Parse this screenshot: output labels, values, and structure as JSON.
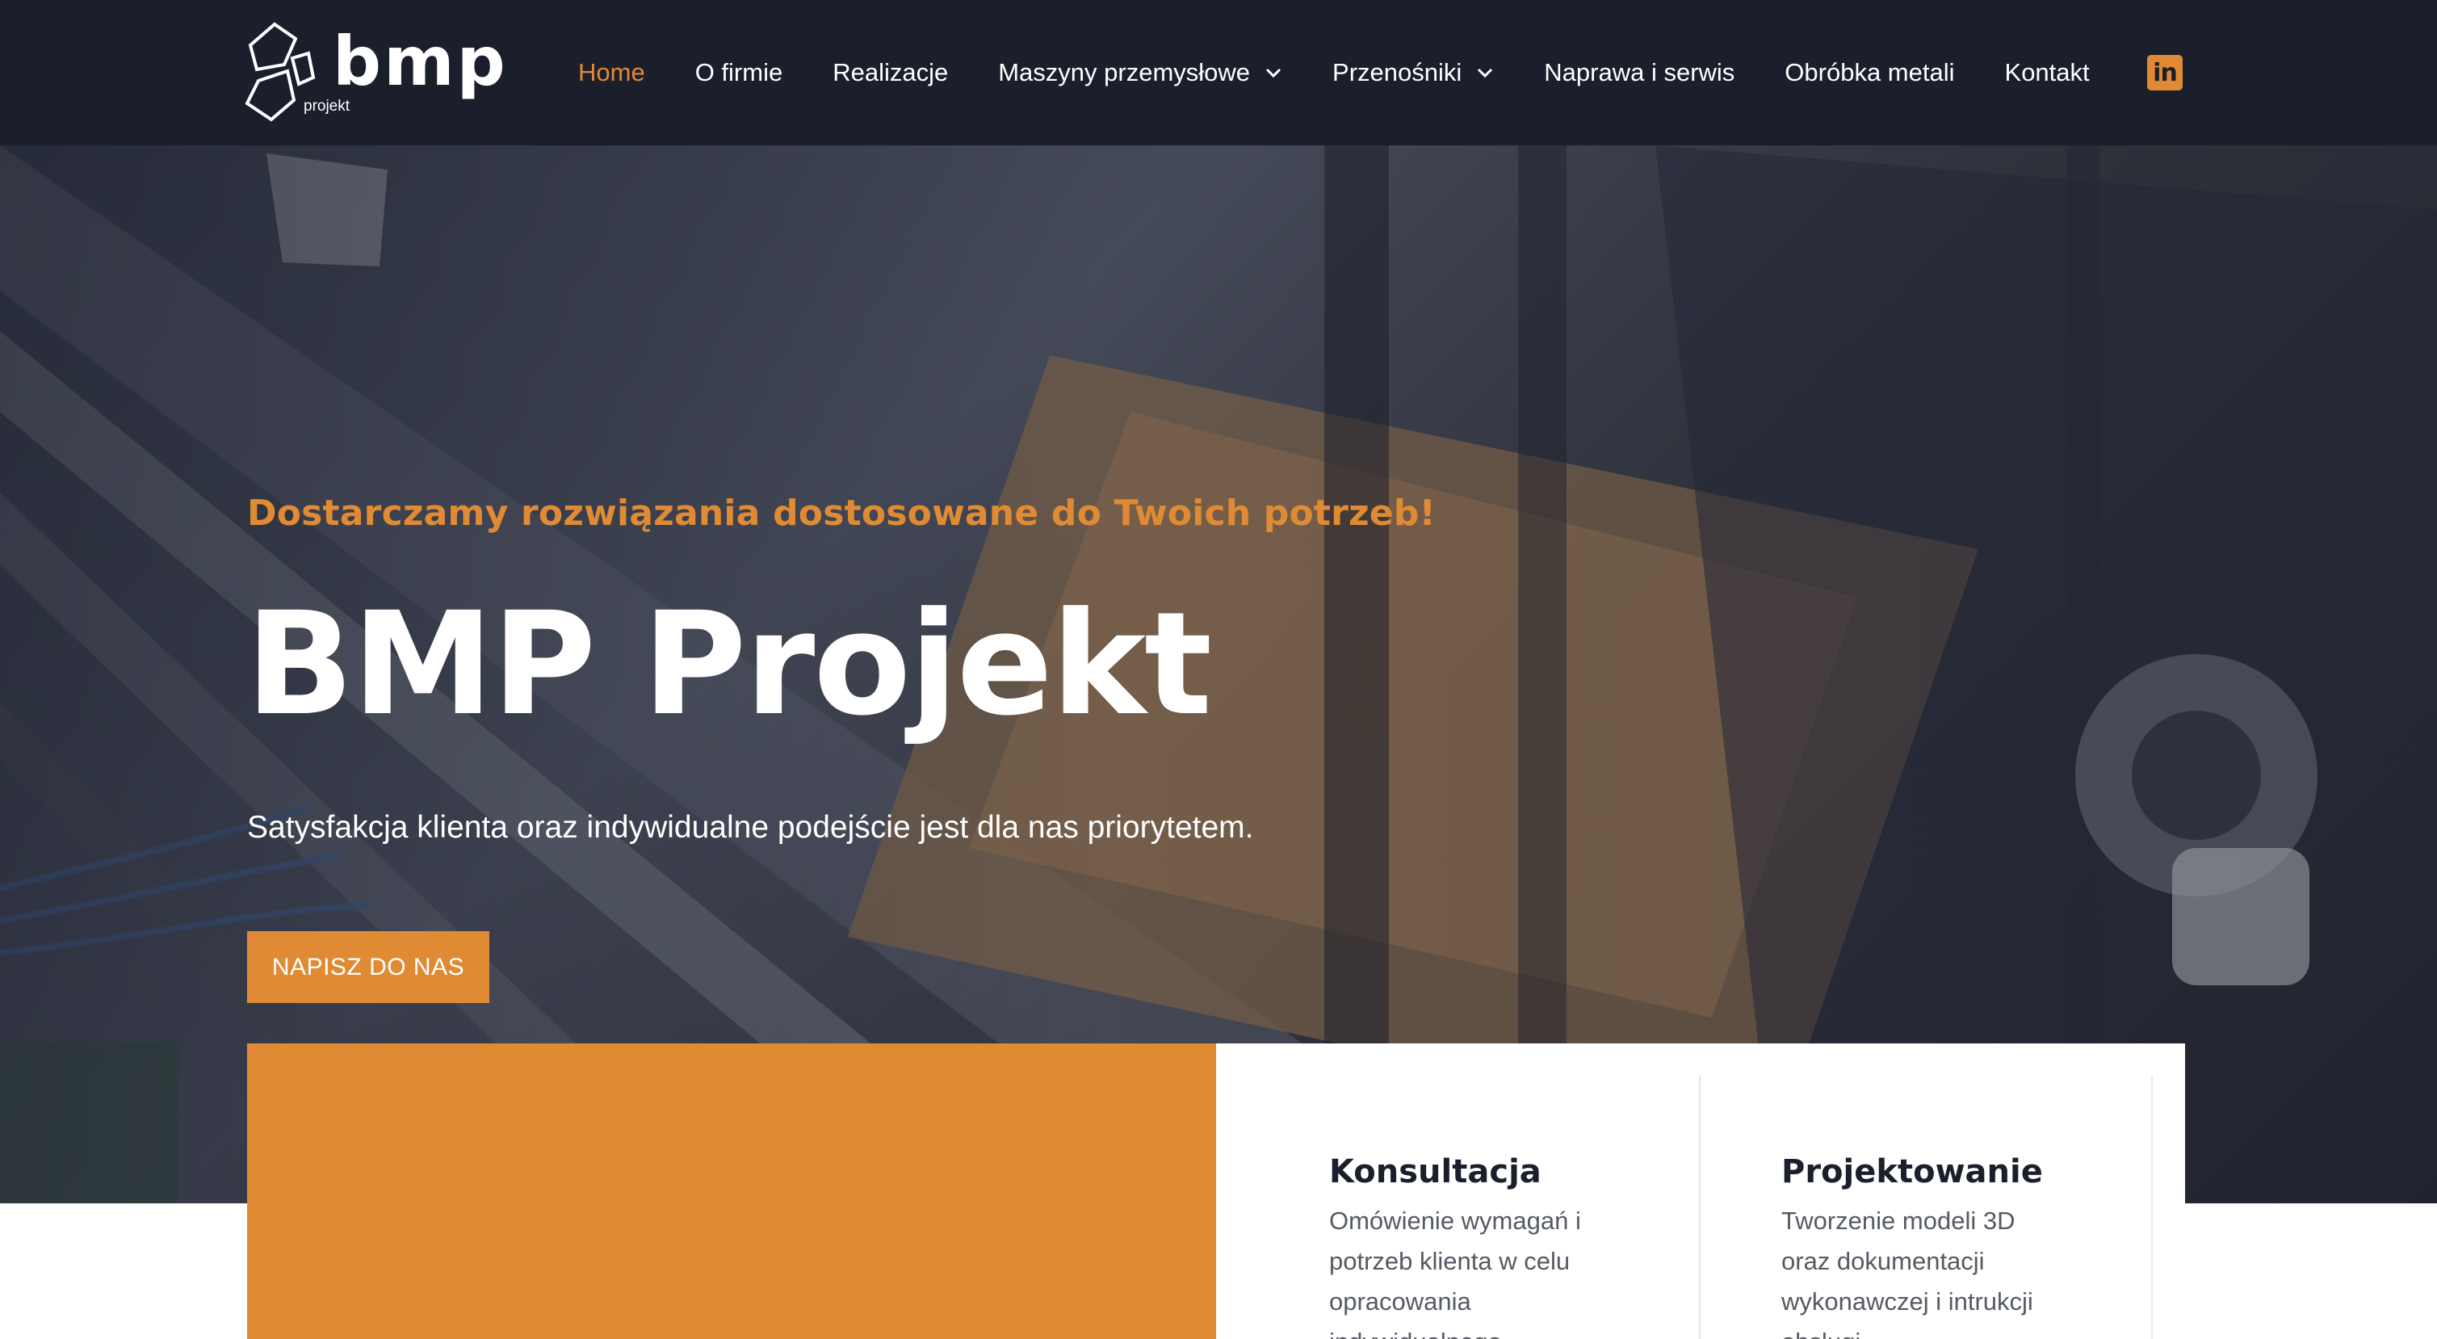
{
  "header": {
    "logo": {
      "word": "bmp",
      "sub": "projekt"
    },
    "nav": [
      {
        "label": "Home",
        "active": true,
        "dropdown": false
      },
      {
        "label": "O firmie",
        "active": false,
        "dropdown": false
      },
      {
        "label": "Realizacje",
        "active": false,
        "dropdown": false
      },
      {
        "label": "Maszyny przemysłowe",
        "active": false,
        "dropdown": true
      },
      {
        "label": "Przenośniki",
        "active": false,
        "dropdown": true
      },
      {
        "label": "Naprawa i serwis",
        "active": false,
        "dropdown": false
      },
      {
        "label": "Obróbka metali",
        "active": false,
        "dropdown": false
      },
      {
        "label": "Kontakt",
        "active": false,
        "dropdown": false
      }
    ],
    "social_icon": "linkedin-icon",
    "social_glyph": "in"
  },
  "hero": {
    "tagline": "Dostarczamy rozwiązania dostosowane do Twoich potrzeb!",
    "title": "BMP Projekt",
    "subtitle": "Satysfakcja klienta oraz indywidualne podejście jest dla nas priorytetem.",
    "cta": "NAPISZ DO NAS"
  },
  "cards": [
    {
      "title": "Konsultacja",
      "lines": [
        "Omówienie wymagań i",
        "potrzeb klienta w celu",
        "opracowania",
        "indywidualnego"
      ]
    },
    {
      "title": "Projektowanie",
      "lines": [
        "Tworzenie modeli 3D",
        "oraz dokumentacji",
        "wykonawczej i intrukcji",
        "obsługi"
      ]
    }
  ],
  "colors": {
    "header_bg": "#1b1f2c",
    "accent": "#e08b33",
    "white": "#ffffff",
    "card_text": "#555a63"
  }
}
